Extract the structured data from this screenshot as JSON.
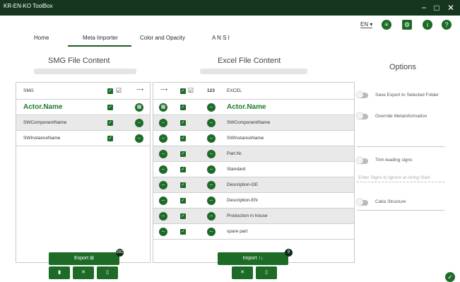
{
  "window": {
    "title": "KR-EN-KO ToolBox",
    "min": "−",
    "max": "□",
    "close": "✕"
  },
  "tabs": [
    "Home",
    "Meta Importer",
    "Color and Opacity",
    "A N S I"
  ],
  "lang": "EN",
  "smg": {
    "title": "SMG File Content",
    "header": "SMG",
    "rows": [
      "Actor.Name",
      "SWComponentName",
      "SWInstanceName"
    ]
  },
  "excel": {
    "title": "Excel File Content",
    "header_num": "123",
    "header": "EXCEL",
    "rows": [
      "Actor.Name",
      "SWComponentName",
      "SWInstanceName",
      "Part.Nr.",
      "Standard",
      "Description-GE",
      "Description-EN",
      "Production in house",
      "spare part"
    ]
  },
  "options": {
    "title": "Options",
    "save_export": "Save Export to Selected Folder",
    "override": "Override Metainformation",
    "trim": "Trim leading signs",
    "trim_placeholder": "Enter Signs to Ignore at string Start",
    "catia": "Catia Structure"
  },
  "buttons": {
    "export": "Export",
    "export_badge": "281",
    "import": "Import",
    "import_badge": "9"
  }
}
